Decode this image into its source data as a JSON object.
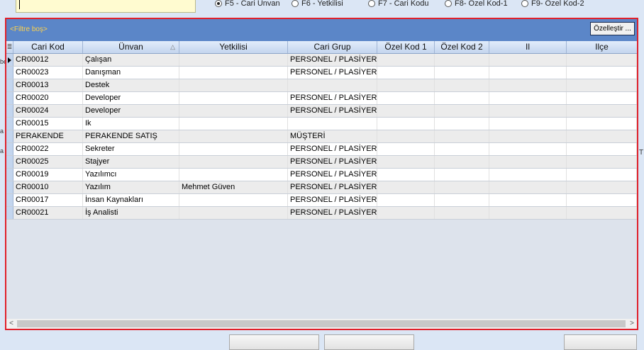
{
  "search": {
    "value": ""
  },
  "radio_options": [
    {
      "label": "F5 - Cari Unvan",
      "selected": true
    },
    {
      "label": "F6 - Yetkilisi",
      "selected": false
    },
    {
      "label": "F7 - Cari Kodu",
      "selected": false
    },
    {
      "label": "F8- Özel Kod-1",
      "selected": false
    },
    {
      "label": "F9- Özel Kod-2",
      "selected": false
    }
  ],
  "edge_fragments": {
    "left_1": "be",
    "left_2": "a",
    "left_3": "a",
    "right_1": "T"
  },
  "filter": {
    "text": "<Filtre boş>",
    "customize_label": "Özelleştir ..."
  },
  "columns": [
    "Cari Kod",
    "Ünvan",
    "Yetkilisi",
    "Cari Grup",
    "Özel Kod 1",
    "Özel Kod 2",
    "Il",
    "Ilçe"
  ],
  "sort_column": "Ünvan",
  "rows": [
    [
      "CR00012",
      "Çalışan",
      "",
      "PERSONEL / PLASİYER",
      "",
      "",
      "",
      ""
    ],
    [
      "CR00023",
      "Danışman",
      "",
      "PERSONEL / PLASİYER",
      "",
      "",
      "",
      ""
    ],
    [
      "CR00013",
      "Destek",
      "",
      "",
      "",
      "",
      "",
      ""
    ],
    [
      "CR00020",
      "Developer",
      "",
      "PERSONEL / PLASİYER",
      "",
      "",
      "",
      ""
    ],
    [
      "CR00024",
      "Developer",
      "",
      "PERSONEL / PLASİYER",
      "",
      "",
      "",
      ""
    ],
    [
      "CR00015",
      "Ik",
      "",
      "",
      "",
      "",
      "",
      ""
    ],
    [
      "PERAKENDE",
      "PERAKENDE SATIŞ",
      "",
      "MÜŞTERİ",
      "",
      "",
      "",
      ""
    ],
    [
      "CR00022",
      "Sekreter",
      "",
      "PERSONEL / PLASİYER",
      "",
      "",
      "",
      ""
    ],
    [
      "CR00025",
      "Stajyer",
      "",
      "PERSONEL / PLASİYER",
      "",
      "",
      "",
      ""
    ],
    [
      "CR00019",
      "Yazılımcı",
      "",
      "PERSONEL / PLASİYER",
      "",
      "",
      "",
      ""
    ],
    [
      "CR00010",
      "Yazılım",
      "Mehmet Güven",
      "PERSONEL / PLASİYER",
      "",
      "",
      "",
      ""
    ],
    [
      "CR00017",
      "İnsan Kaynakları",
      "",
      "PERSONEL / PLASİYER",
      "",
      "",
      "",
      ""
    ],
    [
      "CR00021",
      "İş Analisti",
      "",
      "PERSONEL / PLASİYER",
      "",
      "",
      "",
      ""
    ]
  ],
  "scrollbar": {
    "left_arrow": "<",
    "right_arrow": ">"
  },
  "colors": {
    "accent_border": "#e0202a",
    "filter_panel": "#5b86c8",
    "filter_text": "#ffd24a"
  }
}
